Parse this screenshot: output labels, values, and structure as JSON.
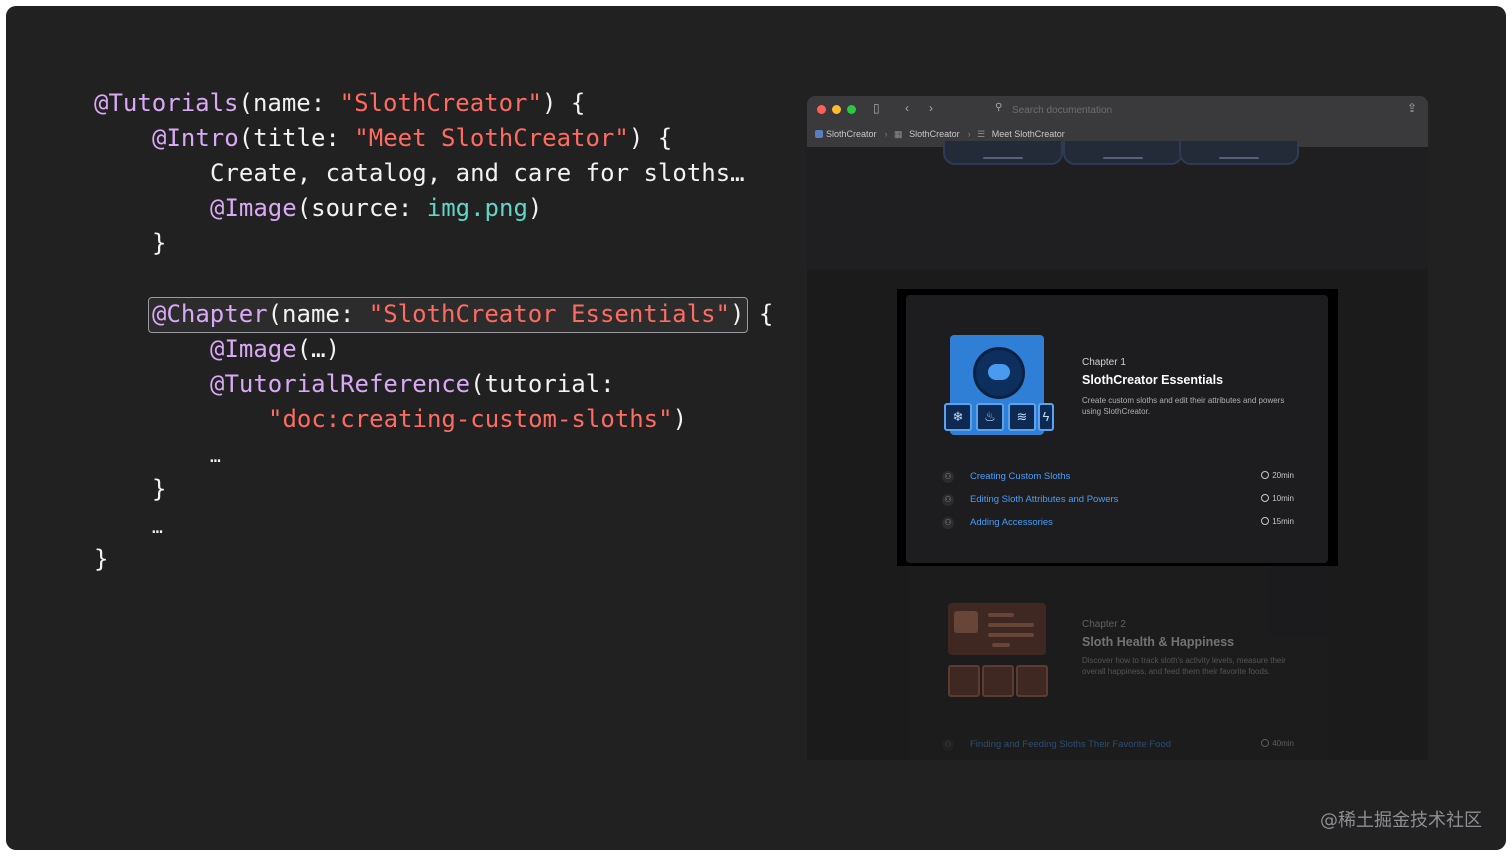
{
  "code": {
    "l1": [
      "@Tutorials",
      "(name: ",
      "\"SlothCreator\"",
      ") {"
    ],
    "l2": [
      "@Intro",
      "(title: ",
      "\"Meet SlothCreator\"",
      ") {"
    ],
    "l3": "Create, catalog, and care for sloths…",
    "l4": [
      "@Image",
      "(source: ",
      "img.png",
      ")"
    ],
    "l5": "}",
    "l6": [
      "@Chapter",
      "(name: ",
      "\"SlothCreator Essentials\"",
      ") {"
    ],
    "l7": [
      "@Image",
      "(…)"
    ],
    "l8": [
      "@TutorialReference",
      "(tutorial:"
    ],
    "l9": [
      "\"doc:creating-custom-sloths\"",
      ")"
    ],
    "l10": "…",
    "l11": "}",
    "l12": "…",
    "l13": "}"
  },
  "browser": {
    "search_placeholder": "Search documentation",
    "breadcrumbs": [
      "SlothCreator",
      "SlothCreator",
      "Meet SlothCreator"
    ],
    "chapter1": {
      "eyebrow": "Chapter 1",
      "title": "SlothCreator Essentials",
      "description": "Create custom sloths and edit their attributes and powers using SlothCreator.",
      "tutorials": [
        {
          "title": "Creating Custom Sloths",
          "time": "20min"
        },
        {
          "title": "Editing Sloth Attributes and Powers",
          "time": "10min"
        },
        {
          "title": "Adding Accessories",
          "time": "15min"
        }
      ]
    },
    "chapter2": {
      "eyebrow": "Chapter 2",
      "title": "Sloth Health & Happiness",
      "description": "Discover how to track sloth's activity levels, measure their overall happiness, and feed them their favorite foods.",
      "tutorials": [
        {
          "title": "Finding and Feeding Sloths Their Favorite Food",
          "time": "40min"
        }
      ]
    }
  },
  "watermark": "@稀土掘金技术社区",
  "colors": {
    "background": "#212122",
    "directive": "#d9a9f5",
    "string": "#ff6b61",
    "literal": "#5fd7c6",
    "link": "#4a9df8"
  }
}
